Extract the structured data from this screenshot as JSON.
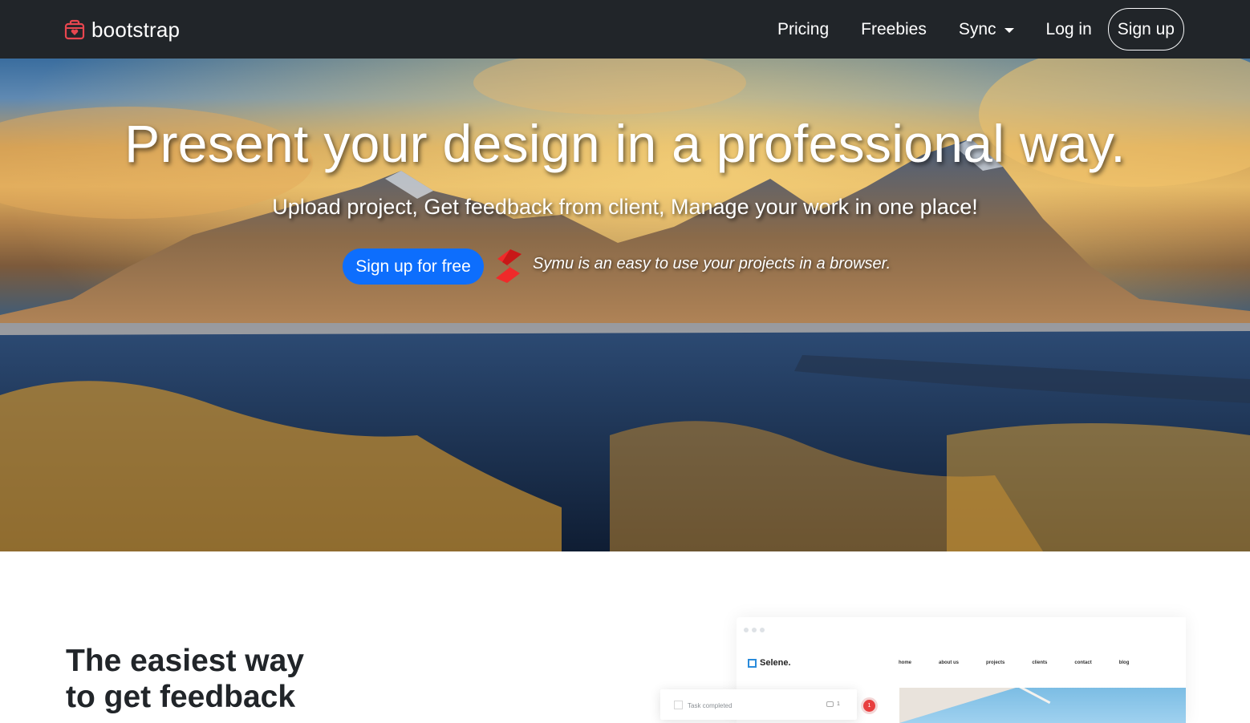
{
  "navbar": {
    "brand": "bootstrap",
    "brand_icon": "heart-box-icon",
    "links": [
      "Pricing",
      "Freebies",
      "Sync",
      "Log in"
    ],
    "signup": "Sign up",
    "dropdown_icon": "caret-down-icon"
  },
  "hero": {
    "title": "Present your design in a professional way.",
    "subtitle": "Upload project, Get feedback from client, Manage your work in one place!",
    "cta": "Sign up for free",
    "promo_text": "Symu is an easy to use your projects in a browser.",
    "promo_icon": "symu-logo-icon"
  },
  "feature": {
    "title_line1": "The easiest way",
    "title_line2": "to get feedback",
    "mock": {
      "brand": "Selene.",
      "nav": [
        "home",
        "about us",
        "projects",
        "clients",
        "contact",
        "blog"
      ],
      "task_text": "Task completed",
      "task_count": "1",
      "notification": "1"
    }
  },
  "colors": {
    "navbar_bg": "#212529",
    "primary": "#0d6efd",
    "brand_icon": "#e8464f",
    "symu_red": "#ef2a2a"
  }
}
